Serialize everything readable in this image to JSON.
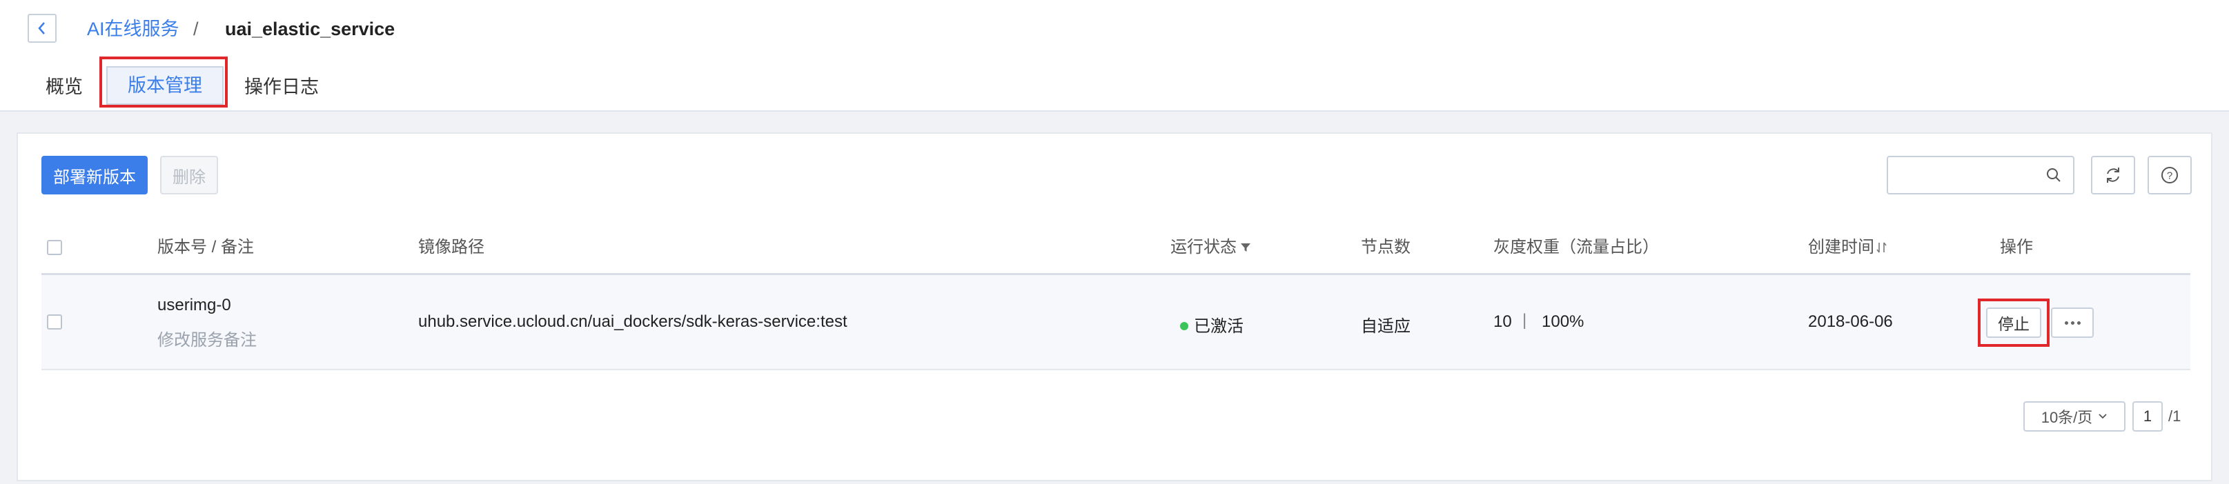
{
  "breadcrumb": {
    "parent": "AI在线服务",
    "separator": "/",
    "current": "uai_elastic_service"
  },
  "tabs": [
    {
      "label": "概览",
      "active": false
    },
    {
      "label": "版本管理",
      "active": true
    },
    {
      "label": "操作日志",
      "active": false
    }
  ],
  "toolbar": {
    "deploy_label": "部署新版本",
    "delete_label": "删除",
    "search_placeholder": ""
  },
  "table": {
    "headers": {
      "version": "版本号 / 备注",
      "image": "镜像路径",
      "status": "运行状态",
      "nodes": "节点数",
      "weight": "灰度权重（流量占比）",
      "created": "创建时间",
      "actions": "操作"
    },
    "rows": [
      {
        "version": "userimg-0",
        "remark": "修改服务备注",
        "image": "uhub.service.ucloud.cn/uai_dockers/sdk-keras-service:test",
        "status": "已激活",
        "nodes": "自适应",
        "weight": "10",
        "weight_sep": "|",
        "ratio": "100%",
        "created": "2018-06-06",
        "stop_label": "停止"
      }
    ]
  },
  "pagination": {
    "page_size": "10条/页",
    "current_page": "1",
    "total": "/1"
  },
  "colors": {
    "accent": "#3b7de9",
    "highlight": "#e0272b",
    "status_active": "#3cc35a"
  },
  "icons": [
    "chevron-left-icon",
    "search-icon",
    "refresh-icon",
    "help-icon",
    "filter-icon",
    "sort-icon",
    "more-icon",
    "chevron-down-icon"
  ]
}
